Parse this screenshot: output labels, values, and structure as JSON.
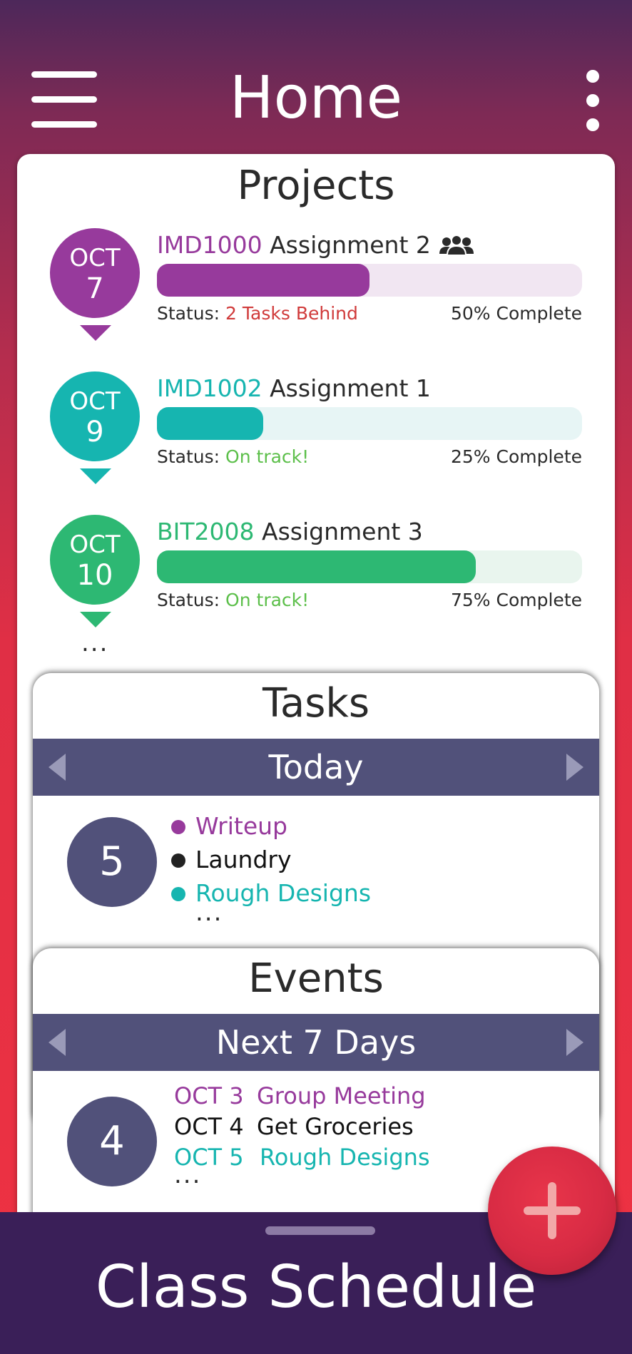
{
  "header": {
    "title": "Home",
    "menu_icon": "hamburger-menu-icon",
    "more_icon": "vertical-dots-icon"
  },
  "projects": {
    "heading": "Projects",
    "items": [
      {
        "month": "OCT",
        "day": "7",
        "course": "IMD1000",
        "name": "Assignment 2",
        "group_icon": "group-icon",
        "status_label": "Status: ",
        "status": "2 Tasks Behind",
        "status_color": "#d03a3a",
        "progress": 0.5,
        "complete_label": "50% Complete",
        "color": "#973a9c",
        "track_color": "#f1e6f2"
      },
      {
        "month": "OCT",
        "day": "9",
        "course": "IMD1002",
        "name": "Assignment 1",
        "status_label": "Status: ",
        "status": "On track!",
        "status_color": "#5cbf4a",
        "progress": 0.25,
        "complete_label": "25% Complete",
        "color": "#16b5b0",
        "track_color": "#e7f5f5"
      },
      {
        "month": "OCT",
        "day": "10",
        "course": "BIT2008",
        "name": "Assignment 3",
        "status_label": "Status: ",
        "status": "On track!",
        "status_color": "#5cbf4a",
        "progress": 0.75,
        "complete_label": "75% Complete",
        "color": "#2db873",
        "track_color": "#e9f5ee"
      }
    ],
    "more": "..."
  },
  "tasks": {
    "heading": "Tasks",
    "period": "Today",
    "count": "5",
    "items": [
      {
        "label": "Writeup",
        "color": "#973a9c"
      },
      {
        "label": "Laundry",
        "color": "#222222"
      },
      {
        "label": "Rough Designs",
        "color": "#16b5b0"
      }
    ],
    "more": "..."
  },
  "events": {
    "heading": "Events",
    "period": "Next 7 Days",
    "count": "4",
    "items": [
      {
        "date": "OCT 3",
        "label": "Group Meeting",
        "color": "#973a9c"
      },
      {
        "date": "OCT 4",
        "label": "Get Groceries",
        "color": "#111111"
      },
      {
        "date": "OCT 5",
        "label": "Rough Designs",
        "color": "#16b5b0"
      }
    ],
    "more": "..."
  },
  "bottom": {
    "title": "Class Schedule"
  },
  "fab": {
    "icon": "plus-icon"
  }
}
